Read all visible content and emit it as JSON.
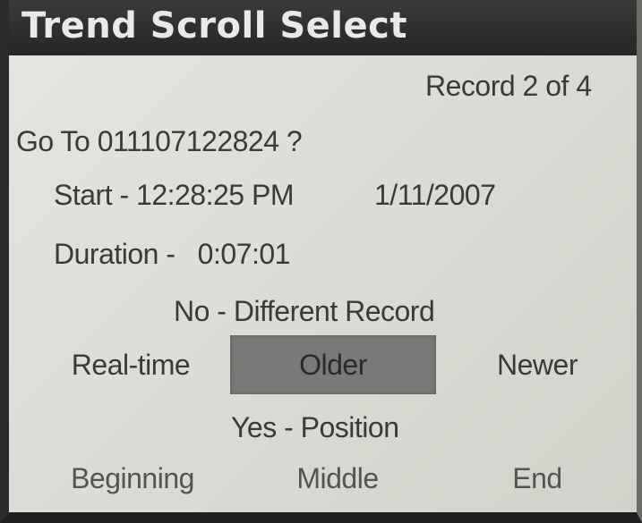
{
  "window": {
    "title": "Trend Scroll Select"
  },
  "record": {
    "counter": "Record 2 of 4",
    "goto_prompt": "Go To 011107122824 ?",
    "start": "Start - 12:28:25 PM",
    "start_date": "1/11/2007",
    "duration": "Duration -   0:07:01"
  },
  "no_section": {
    "heading": "No - Different Record",
    "buttons": {
      "realtime": "Real-time",
      "older": "Older",
      "newer": "Newer"
    },
    "selected": "Older"
  },
  "yes_section": {
    "heading": "Yes - Position",
    "buttons": {
      "beginning": "Beginning",
      "middle": "Middle",
      "end": "End"
    }
  },
  "colors": {
    "title_bar": "#2e2e2e",
    "screen_bg": "#dddcd6",
    "selected_button": "#7a7978",
    "text": "#3a3a3a"
  }
}
